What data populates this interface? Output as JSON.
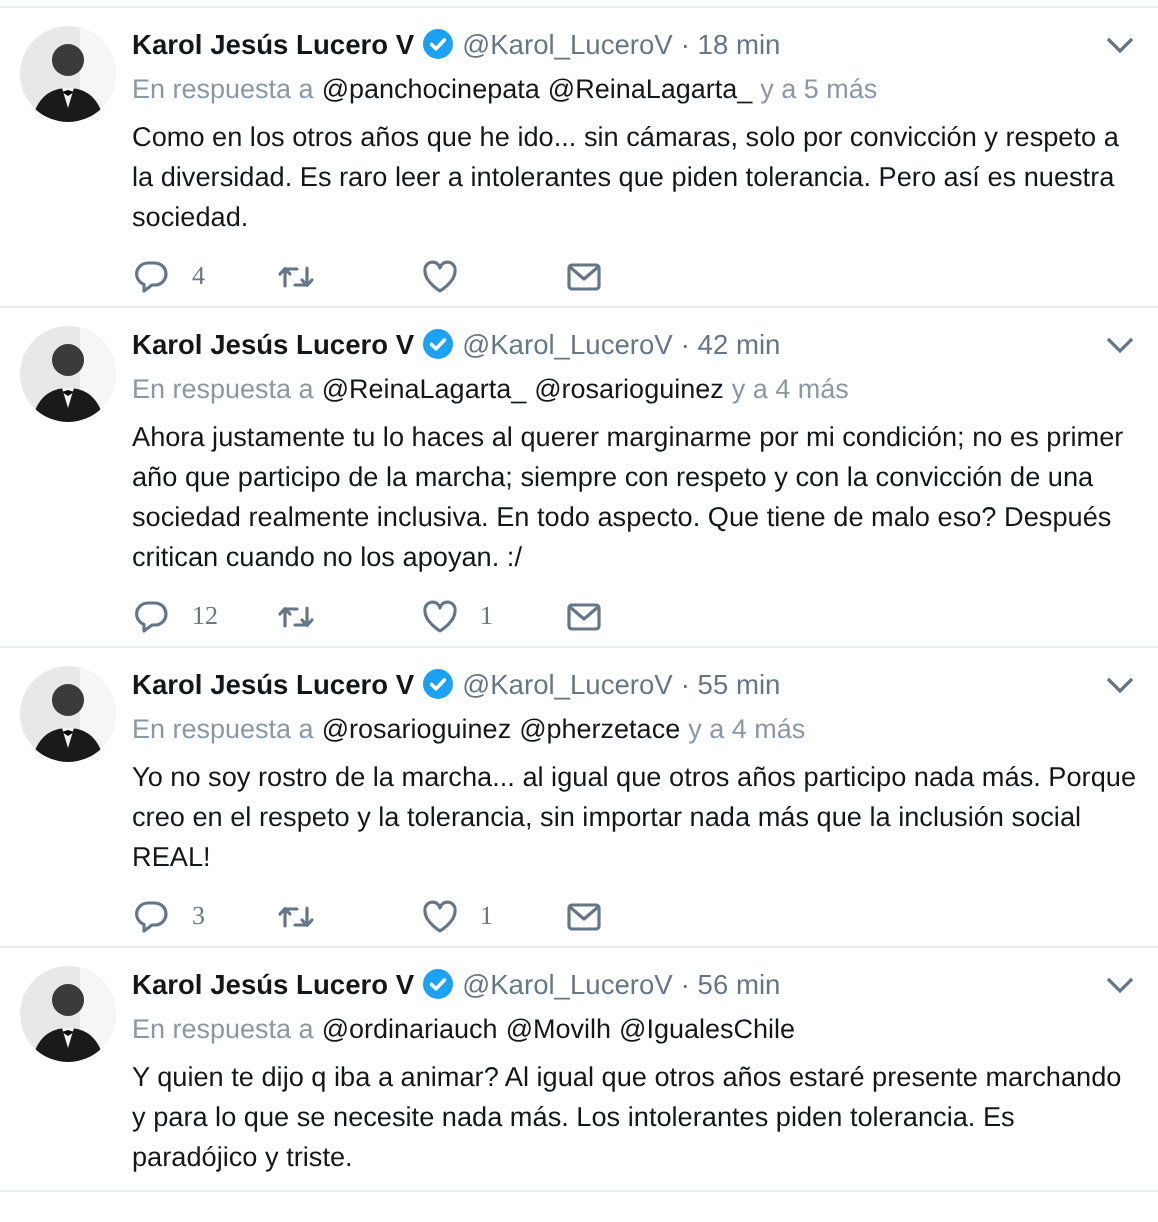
{
  "tweets": [
    {
      "name": "Karol Jesús Lucero V",
      "verified": true,
      "handle": "@Karol_LuceroV",
      "time": "· 18 min",
      "reply_prefix": "En respuesta a",
      "mentions": [
        "@panchocinepata",
        "@ReinaLagarta_"
      ],
      "reply_suffix": "y a 5 más",
      "text": "Como en los otros años que he ido... sin cámaras, solo por convicción y respeto a la diversidad. Es raro leer a intolerantes que piden tolerancia. Pero así es nuestra sociedad.",
      "replies": "4"
    },
    {
      "name": "Karol Jesús Lucero V",
      "verified": true,
      "handle": "@Karol_LuceroV",
      "time": "· 42 min",
      "reply_prefix": "En respuesta a",
      "mentions": [
        "@ReinaLagarta_",
        "@rosarioguinez"
      ],
      "reply_suffix": "y a 4 más",
      "text": "Ahora justamente tu lo haces al querer marginarme por mi condición; no es primer año que participo de la marcha; siempre con respeto y con la convicción de una sociedad realmente inclusiva. En todo aspecto. Que tiene de malo eso? Después critican cuando no los apoyan. :/",
      "replies": "12",
      "likes": "1"
    },
    {
      "name": "Karol Jesús Lucero V",
      "verified": true,
      "handle": "@Karol_LuceroV",
      "time": "· 55 min",
      "reply_prefix": "En respuesta a",
      "mentions": [
        "@rosarioguinez",
        "@pherzetace"
      ],
      "reply_suffix": "y a 4 más",
      "text": "Yo no soy rostro de la marcha... al igual que otros años participo nada más. Porque creo en el respeto y la tolerancia, sin importar nada más que la inclusión social REAL!",
      "replies": "3",
      "likes": "1"
    },
    {
      "name": "Karol Jesús Lucero V",
      "verified": true,
      "handle": "@Karol_LuceroV",
      "time": "· 56 min",
      "reply_prefix": "En respuesta a",
      "mentions": [
        "@ordinariauch",
        "@Movilh",
        "@IgualesChile"
      ],
      "text": "Y quien te dijo q iba a animar? Al igual que otros años estaré presente marchando y para lo que se necesite nada más. Los intolerantes piden tolerancia. Es paradójico y triste."
    }
  ]
}
